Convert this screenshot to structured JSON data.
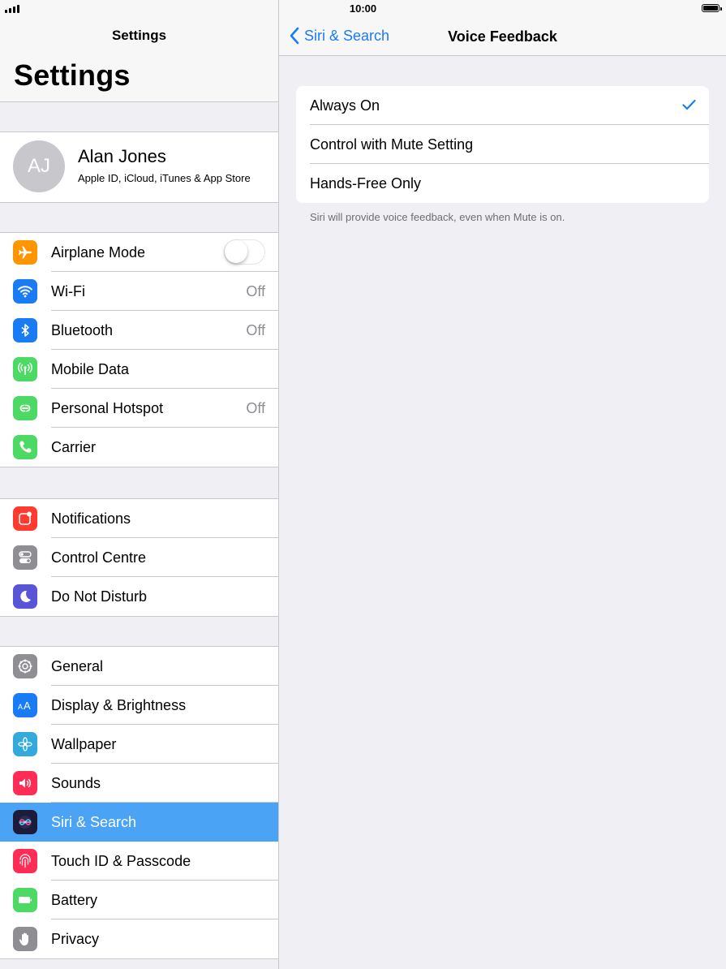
{
  "status": {
    "time": "10:00"
  },
  "left": {
    "nav_title": "Settings",
    "large_title": "Settings",
    "profile": {
      "initials": "AJ",
      "name": "Alan Jones",
      "subtitle": "Apple ID, iCloud, iTunes & App Store"
    },
    "group1": [
      {
        "label": "Airplane Mode",
        "toggle": false,
        "icon": "airplane-icon",
        "color": "#ff9500"
      },
      {
        "label": "Wi-Fi",
        "value": "Off",
        "icon": "wifi-icon",
        "color": "#1a7cf5"
      },
      {
        "label": "Bluetooth",
        "value": "Off",
        "icon": "bluetooth-icon",
        "color": "#1a7cf5"
      },
      {
        "label": "Mobile Data",
        "icon": "antenna-icon",
        "color": "#4cd964"
      },
      {
        "label": "Personal Hotspot",
        "value": "Off",
        "icon": "hotspot-icon",
        "color": "#4cd964"
      },
      {
        "label": "Carrier",
        "icon": "phone-icon",
        "color": "#4cd964"
      }
    ],
    "group2": [
      {
        "label": "Notifications",
        "icon": "notifications-icon",
        "color": "#ff3b30"
      },
      {
        "label": "Control Centre",
        "icon": "control-centre-icon",
        "color": "#8e8e93"
      },
      {
        "label": "Do Not Disturb",
        "icon": "moon-icon",
        "color": "#5856d6"
      }
    ],
    "group3": [
      {
        "label": "General",
        "icon": "gear-icon",
        "color": "#8e8e93"
      },
      {
        "label": "Display & Brightness",
        "icon": "display-icon",
        "color": "#1a7cf5"
      },
      {
        "label": "Wallpaper",
        "icon": "wallpaper-icon",
        "color": "#34aadc"
      },
      {
        "label": "Sounds",
        "icon": "speaker-icon",
        "color": "#ff2d55"
      },
      {
        "label": "Siri & Search",
        "icon": "siri-icon",
        "color": "#1c1c3a",
        "selected": true
      },
      {
        "label": "Touch ID & Passcode",
        "icon": "fingerprint-icon",
        "color": "#ff2d55"
      },
      {
        "label": "Battery",
        "icon": "battery-icon",
        "color": "#4cd964"
      },
      {
        "label": "Privacy",
        "icon": "hand-icon",
        "color": "#8e8e93"
      }
    ]
  },
  "right": {
    "back_label": "Siri & Search",
    "title": "Voice Feedback",
    "options": [
      {
        "label": "Always On",
        "checked": true
      },
      {
        "label": "Control with Mute Setting",
        "checked": false
      },
      {
        "label": "Hands-Free Only",
        "checked": false
      }
    ],
    "footer": "Siri will provide voice feedback, even when Mute is on."
  },
  "colors": {
    "accent": "#1a7cf5",
    "selection": "#4aa3f4",
    "background": "#efeff4"
  }
}
